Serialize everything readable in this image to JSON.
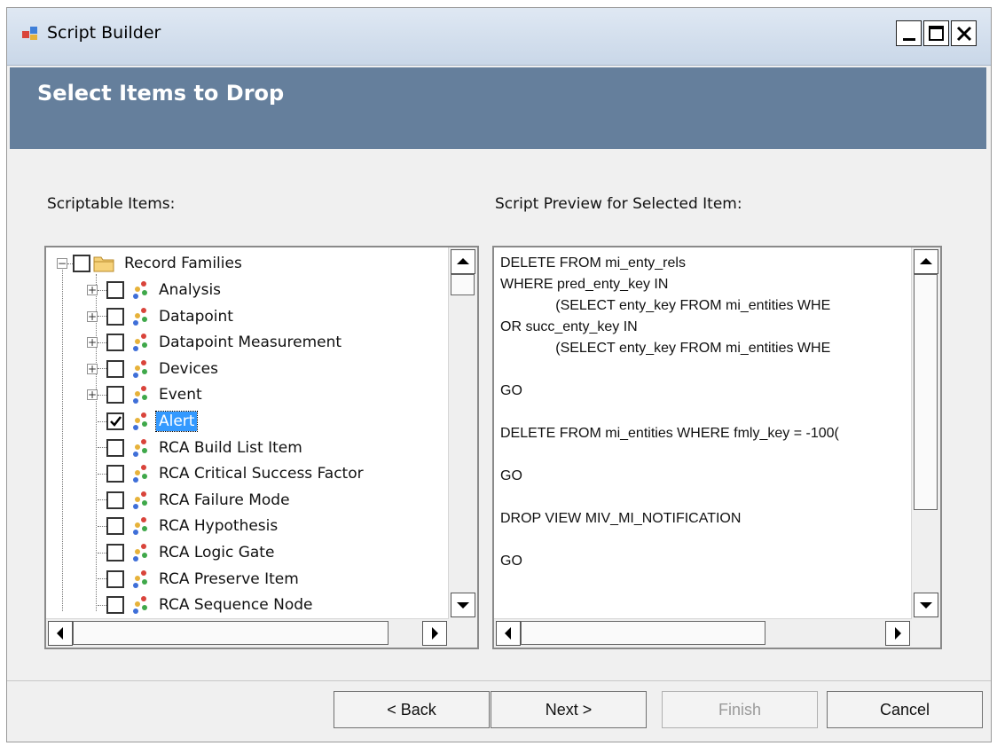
{
  "window": {
    "title": "Script Builder",
    "controls": {
      "minimize": "_",
      "maximize": "☐",
      "close": "X"
    }
  },
  "header": {
    "title": "Select Items to Drop"
  },
  "left_panel": {
    "label": "Scriptable Items:",
    "root": {
      "label": "Record Families",
      "expander": "⊟",
      "checked": false,
      "icon": "folder-icon"
    },
    "items": [
      {
        "label": "Analysis",
        "expander": "+",
        "checked": false
      },
      {
        "label": "Datapoint",
        "expander": "+",
        "checked": false
      },
      {
        "label": "Datapoint Measurement",
        "expander": "+",
        "checked": false
      },
      {
        "label": "Devices",
        "expander": "+",
        "checked": false
      },
      {
        "label": "Event",
        "expander": "+",
        "checked": false
      },
      {
        "label": "Alert",
        "expander": "",
        "checked": true,
        "selected": true
      },
      {
        "label": "RCA Build List Item",
        "expander": "",
        "checked": false
      },
      {
        "label": "RCA Critical Success Factor",
        "expander": "",
        "checked": false
      },
      {
        "label": "RCA Failure Mode",
        "expander": "",
        "checked": false
      },
      {
        "label": "RCA Hypothesis",
        "expander": "",
        "checked": false
      },
      {
        "label": "RCA Logic Gate",
        "expander": "",
        "checked": false
      },
      {
        "label": "RCA Preserve Item",
        "expander": "",
        "checked": false
      },
      {
        "label": "RCA Sequence Node",
        "expander": "",
        "checked": false
      }
    ]
  },
  "right_panel": {
    "label": "Script Preview for Selected Item:",
    "script": "DELETE FROM mi_enty_rels\nWHERE pred_enty_key IN\n              (SELECT enty_key FROM mi_entities WHE\nOR succ_enty_key IN\n              (SELECT enty_key FROM mi_entities WHE\n\nGO\n\nDELETE FROM mi_entities WHERE fmly_key = -100(\n\nGO\n\nDROP VIEW MIV_MI_NOTIFICATION\n\nGO"
  },
  "buttons": {
    "back": "< Back",
    "next": "Next >",
    "finish": "Finish",
    "cancel": "Cancel"
  },
  "colors": {
    "header_bg": "#657f9c",
    "selection": "#3399ff",
    "titlebar": "#c9d7e8"
  }
}
